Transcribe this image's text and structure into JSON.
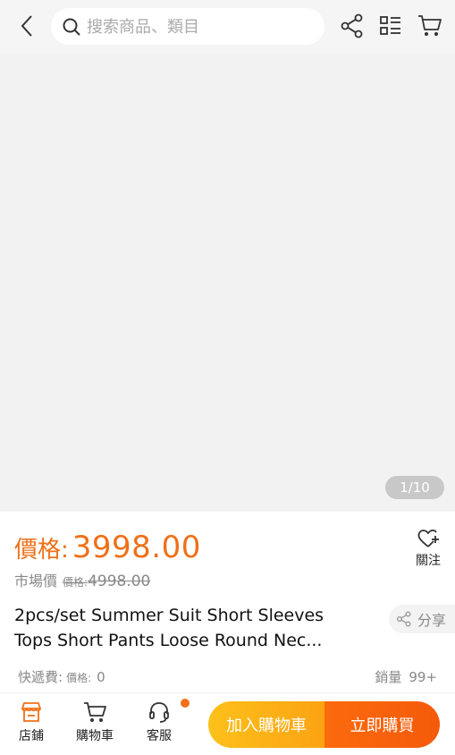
{
  "header": {
    "search_placeholder": "搜索商品、類目",
    "icons": [
      "back-arrow-icon",
      "search-icon",
      "share-icon",
      "category-list-icon",
      "cart-icon"
    ]
  },
  "gallery": {
    "counter": "1/10"
  },
  "product": {
    "price_label": "價格",
    "price_colon": ":",
    "price": "3998.00",
    "follow_label": "關注",
    "market_label": "市場價",
    "market_sub_label": "價格:",
    "market_price": "4998.00",
    "title_line1": "2pcs/set Summer Suit Short Sleeves",
    "title_line2": "Tops Short Pants Loose Round Nec...",
    "share_label": "分享",
    "shipping_label": "快遞費:",
    "shipping_sub_label": "價格:",
    "shipping_fee": "0",
    "sales_label": "銷量",
    "sales_count": "99+"
  },
  "bottom_bar": {
    "store_label": "店鋪",
    "cart_label": "購物車",
    "service_label": "客服",
    "add_to_cart_label": "加入購物車",
    "buy_now_label": "立即購買"
  },
  "colors": {
    "accent": "#f07018",
    "cart_button": "#fdb416",
    "buy_button": "#f8620b"
  }
}
